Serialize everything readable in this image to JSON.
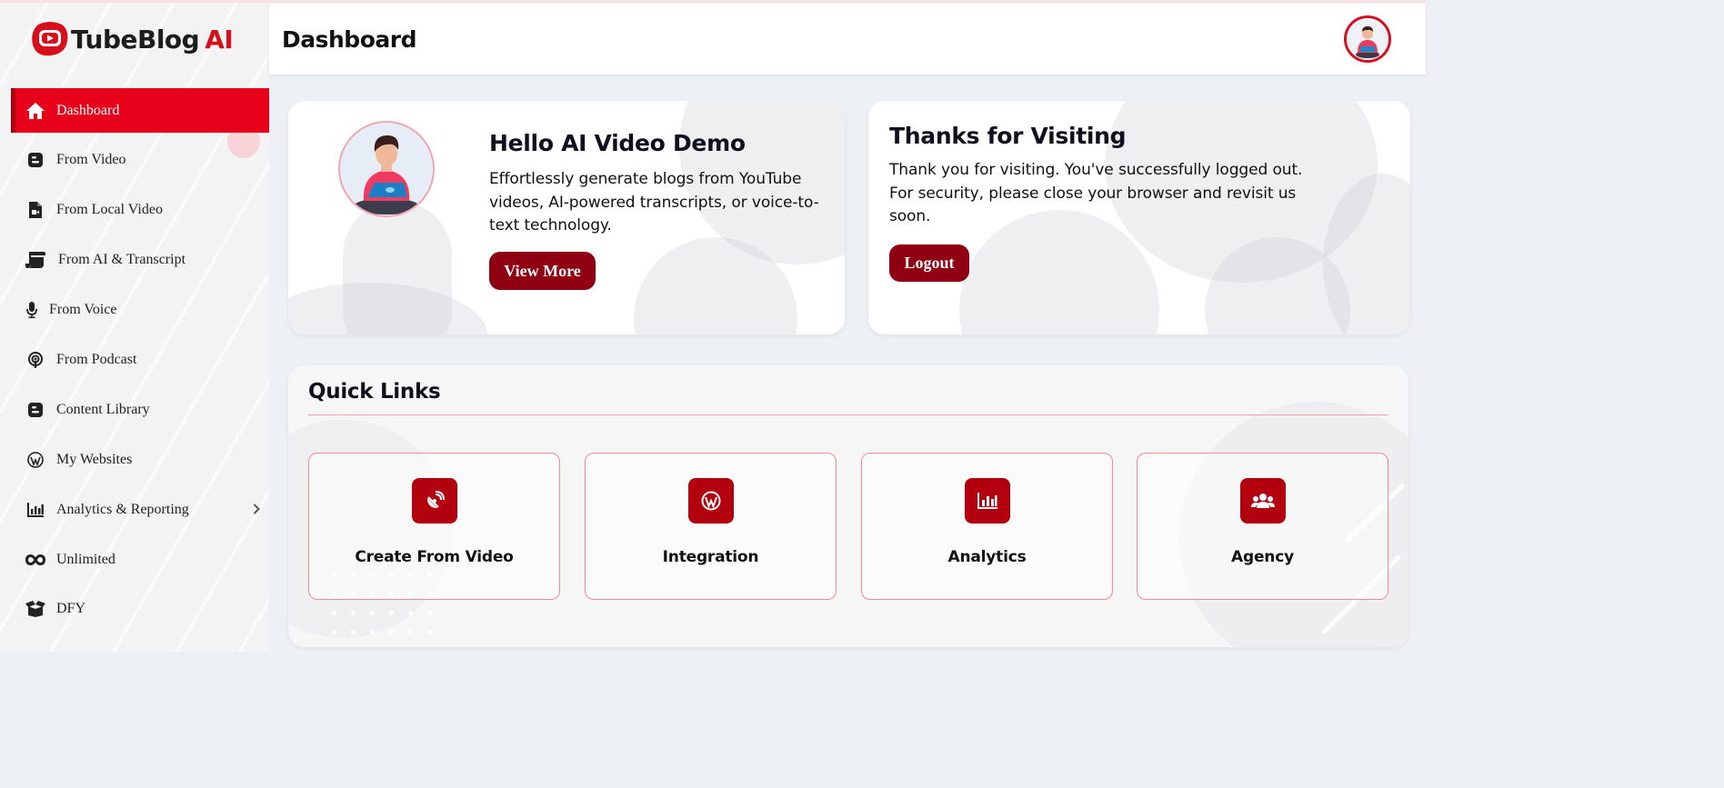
{
  "brand": {
    "name": "TubeBlog",
    "suffix": "AI",
    "accent": "#e8011b"
  },
  "header": {
    "title": "Dashboard"
  },
  "sidebar": {
    "items": [
      {
        "label": "Dashboard",
        "icon": "home-icon",
        "active": true
      },
      {
        "label": "From Video",
        "icon": "blogger-icon"
      },
      {
        "label": "From Local Video",
        "icon": "file-video-icon"
      },
      {
        "label": "From AI & Transcript",
        "icon": "scroll-icon"
      },
      {
        "label": "From Voice",
        "icon": "microphone-icon"
      },
      {
        "label": "From Podcast",
        "icon": "podcast-icon"
      },
      {
        "label": "Content Library",
        "icon": "blogger-icon"
      },
      {
        "label": "My Websites",
        "icon": "wordpress-icon"
      },
      {
        "label": "Analytics & Reporting",
        "icon": "bar-chart-icon",
        "has_submenu": true
      },
      {
        "label": "Unlimited",
        "icon": "infinity-icon"
      },
      {
        "label": "DFY",
        "icon": "box-open-icon"
      }
    ]
  },
  "hello_card": {
    "title": "Hello AI Video Demo",
    "text": "Effortlessly generate blogs from YouTube videos, AI-powered transcripts, or voice-to-text technology.",
    "button": "View More"
  },
  "thanks_card": {
    "title": "Thanks for Visiting",
    "text": "Thank you for visiting. You've successfully logged out. For security, please close your browser and revisit us soon.",
    "button": "Logout"
  },
  "quick_links": {
    "title": "Quick Links",
    "items": [
      {
        "label": "Create From Video",
        "icon": "satellite-dish-icon"
      },
      {
        "label": "Integration",
        "icon": "wordpress-icon"
      },
      {
        "label": "Analytics",
        "icon": "bar-chart-icon"
      },
      {
        "label": "Agency",
        "icon": "users-icon"
      }
    ]
  }
}
